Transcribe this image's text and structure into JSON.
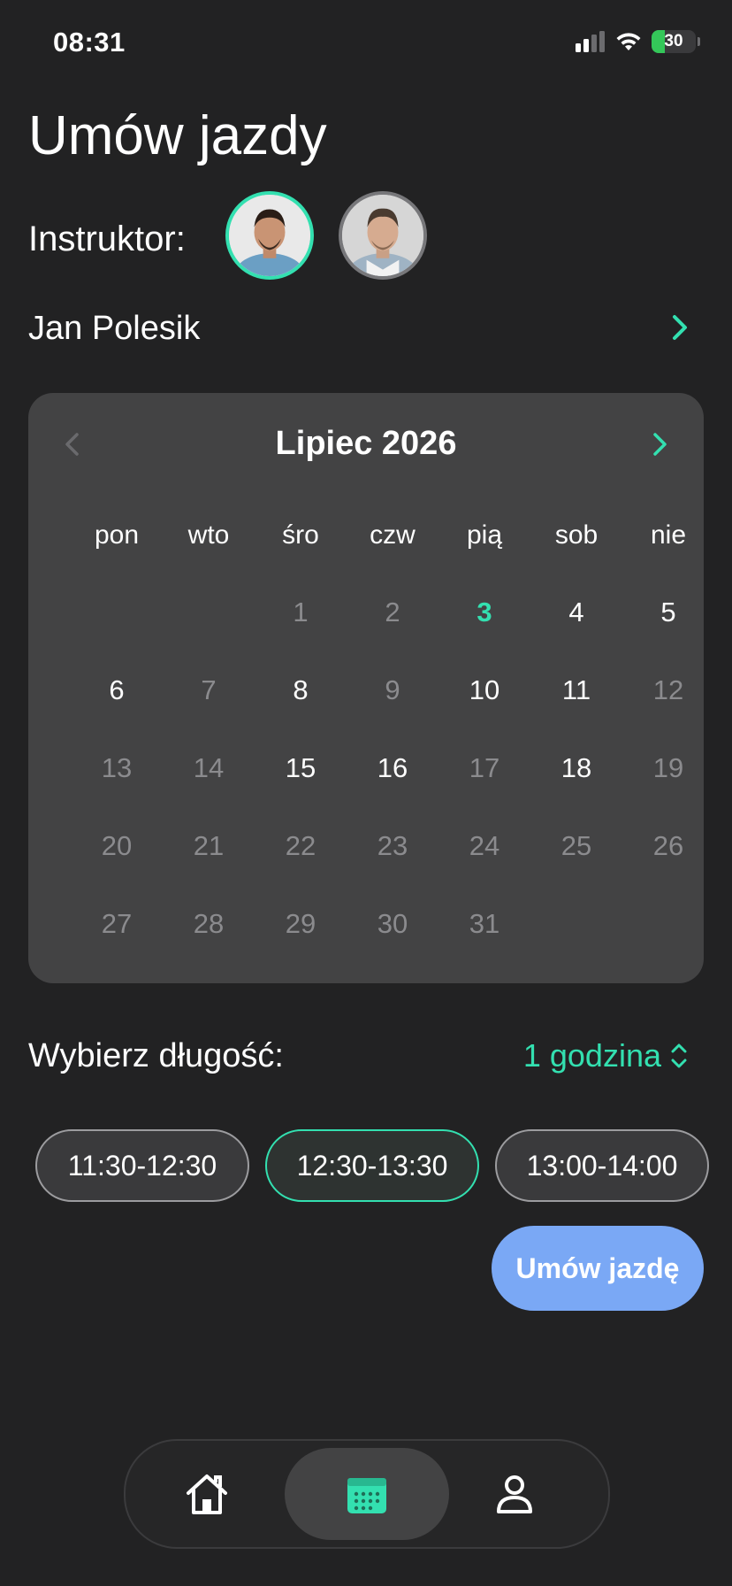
{
  "status_bar": {
    "time": "08:31",
    "battery": "30"
  },
  "header": {
    "title": "Umów jazdy",
    "instructor_label": "Instruktor:",
    "instructor_name": "Jan Polesik"
  },
  "calendar": {
    "month_label": "Lipiec 2026",
    "weekdays": [
      "pon",
      "wto",
      "śro",
      "czw",
      "pią",
      "sob",
      "nie"
    ],
    "days": [
      {
        "label": "",
        "state": "empty"
      },
      {
        "label": "",
        "state": "empty"
      },
      {
        "label": "1",
        "state": "unavailable"
      },
      {
        "label": "2",
        "state": "unavailable"
      },
      {
        "label": "3",
        "state": "today"
      },
      {
        "label": "4",
        "state": "available"
      },
      {
        "label": "5",
        "state": "available"
      },
      {
        "label": "6",
        "state": "available"
      },
      {
        "label": "7",
        "state": "unavailable"
      },
      {
        "label": "8",
        "state": "available"
      },
      {
        "label": "9",
        "state": "unavailable"
      },
      {
        "label": "10",
        "state": "available"
      },
      {
        "label": "11",
        "state": "available"
      },
      {
        "label": "12",
        "state": "unavailable"
      },
      {
        "label": "13",
        "state": "unavailable"
      },
      {
        "label": "14",
        "state": "unavailable"
      },
      {
        "label": "15",
        "state": "available"
      },
      {
        "label": "16",
        "state": "available"
      },
      {
        "label": "17",
        "state": "unavailable"
      },
      {
        "label": "18",
        "state": "available"
      },
      {
        "label": "19",
        "state": "unavailable"
      },
      {
        "label": "20",
        "state": "unavailable"
      },
      {
        "label": "21",
        "state": "unavailable"
      },
      {
        "label": "22",
        "state": "unavailable"
      },
      {
        "label": "23",
        "state": "unavailable"
      },
      {
        "label": "24",
        "state": "unavailable"
      },
      {
        "label": "25",
        "state": "unavailable"
      },
      {
        "label": "26",
        "state": "unavailable"
      },
      {
        "label": "27",
        "state": "unavailable"
      },
      {
        "label": "28",
        "state": "unavailable"
      },
      {
        "label": "29",
        "state": "unavailable"
      },
      {
        "label": "30",
        "state": "unavailable"
      },
      {
        "label": "31",
        "state": "unavailable"
      }
    ]
  },
  "duration": {
    "label": "Wybierz długość:",
    "value": "1 godzina"
  },
  "time_slots": [
    {
      "label": "11:30-12:30",
      "selected": false
    },
    {
      "label": "12:30-13:30",
      "selected": true
    },
    {
      "label": "13:00-14:00",
      "selected": false
    }
  ],
  "book_button": "Umów jazdę",
  "tab_bar": {
    "items": [
      {
        "icon": "home-icon",
        "active": false
      },
      {
        "icon": "calendar-icon",
        "active": true
      },
      {
        "icon": "profile-icon",
        "active": false
      }
    ]
  },
  "colors": {
    "background": "#222223",
    "card": "#434344",
    "accent": "#33e0b0",
    "button": "#7aa8f5",
    "battery": "#34c759"
  }
}
